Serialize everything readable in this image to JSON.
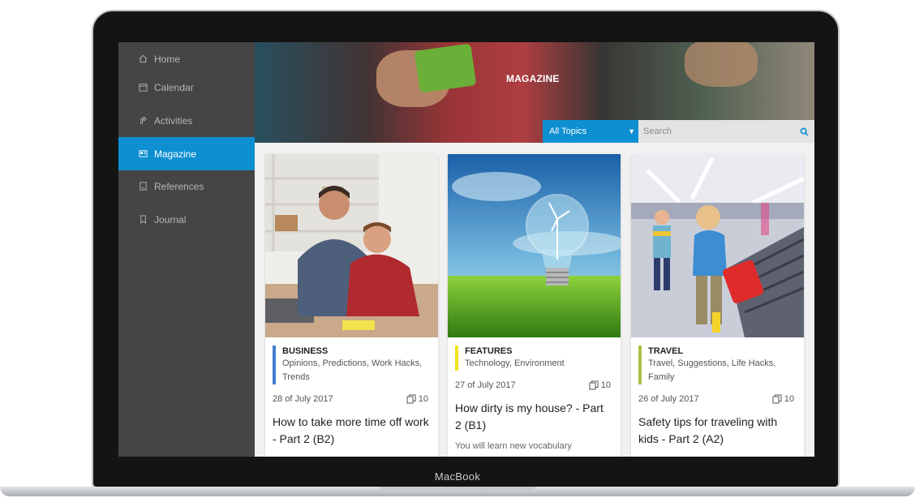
{
  "device": {
    "brand_label": "MacBook"
  },
  "sidebar": {
    "items": [
      {
        "label": "Home",
        "icon": "home-icon"
      },
      {
        "label": "Calendar",
        "icon": "calendar-icon"
      },
      {
        "label": "Activities",
        "icon": "activities-icon"
      },
      {
        "label": "Magazine",
        "icon": "magazine-icon",
        "active": true
      },
      {
        "label": "References",
        "icon": "references-icon"
      },
      {
        "label": "Journal",
        "icon": "bookmark-icon"
      }
    ]
  },
  "hero": {
    "title": "MAGAZINE"
  },
  "filters": {
    "topic_selected": "All Topics",
    "search_placeholder": "Search"
  },
  "colors": {
    "accent": "#0d8fd1",
    "sidebar_bg": "#454545",
    "business": "#3f7dd1",
    "features": "#f2e21d",
    "travel": "#a7c24a"
  },
  "cards": [
    {
      "category": "BUSINESS",
      "tags": "Opinions, Predictions, Work Hacks, Trends",
      "date": "28 of July 2017",
      "count": "10",
      "title": "How to take more time off work - Part 2 (B2)"
    },
    {
      "category": "FEATURES",
      "tags": "Technology, Environment",
      "date": "27 of July 2017",
      "count": "10",
      "title": "How dirty is my house? - Part 2 (B1)",
      "description": "You will learn new vocabulary"
    },
    {
      "category": "TRAVEL",
      "tags": "Travel, Suggestions, Life Hacks, Family",
      "date": "26 of July 2017",
      "count": "10",
      "title": "Safety tips for traveling with kids - Part 2 (A2)"
    }
  ]
}
